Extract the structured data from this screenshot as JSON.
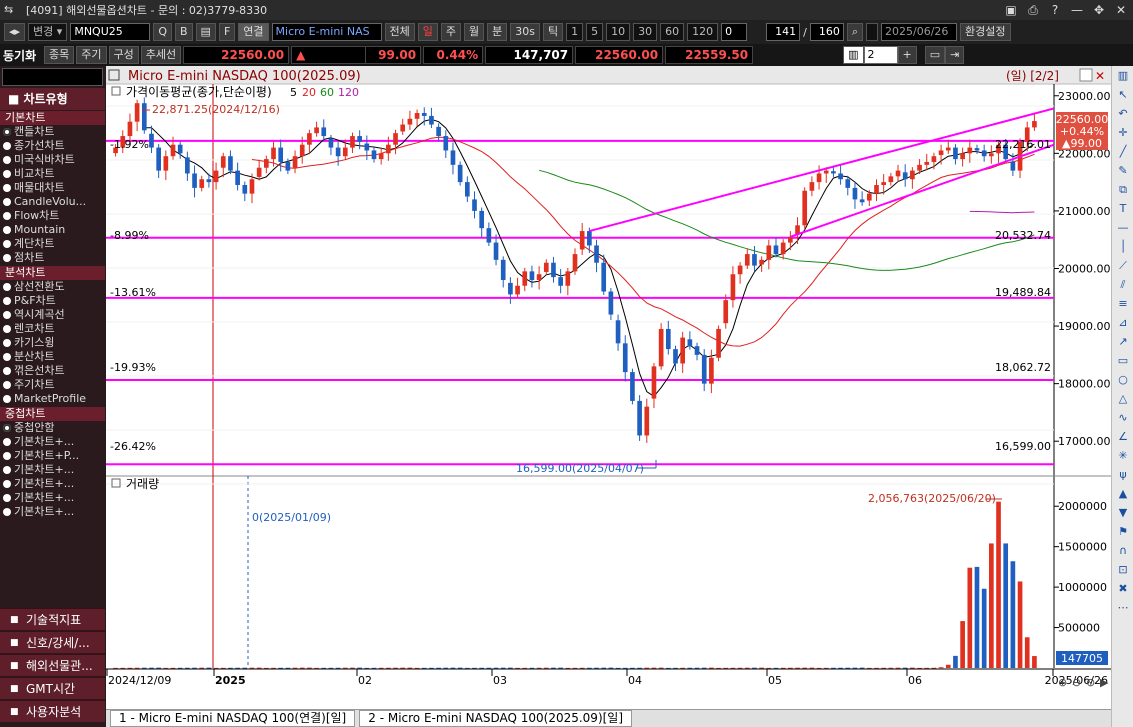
{
  "window": {
    "title": "[4091] 해외선물옵션차트 - 문의 : 02)3779-8330"
  },
  "toolbar": {
    "change_label": "변경",
    "symbol": "MNQU25",
    "connect_label": "연결",
    "symbol_name": "Micro E-mini NAS",
    "all_label": "전체",
    "periods": [
      "일",
      "주",
      "월",
      "분",
      "30s",
      "틱"
    ],
    "intervals": [
      "1",
      "5",
      "10",
      "30",
      "60",
      "120"
    ],
    "field_0": "0",
    "count": "141",
    "total": "160",
    "date": "2025/06/26",
    "settings_label": "환경설정"
  },
  "quote_bar": {
    "sync_label": "동기화",
    "item_label": "종목",
    "cycle_label": "주기",
    "compose_label": "구성",
    "trend_label": "추세선",
    "price": "22560.00",
    "change_arrow": "▲",
    "change": "99.00",
    "change_pct": "0.44%",
    "volume": "147,707",
    "bid": "22560.00",
    "ask": "22559.50",
    "layout_num": "2"
  },
  "sidebar": {
    "header": "차트유형",
    "groups": [
      {
        "name": "기본차트",
        "items": [
          "캔들차트",
          "종가선차트",
          "미국식바차트",
          "비교차트",
          "매물대차트",
          "CandleVolu...",
          "Flow차트",
          "Mountain",
          "계단차트",
          "점차트"
        ]
      },
      {
        "name": "분석차트",
        "items": [
          "삼선전환도",
          "P&F차트",
          "역시계곡선",
          "렌코차트",
          "카기스윙",
          "분산차트",
          "꺾은선차트",
          "주기차트",
          "MarketProfile"
        ]
      },
      {
        "name": "중첩차트",
        "items": [
          "중첩안함",
          "기본차트+...",
          "기본차트+P...",
          "기본차트+...",
          "기본차트+...",
          "기본차트+...",
          "기본차트+..."
        ]
      }
    ],
    "bottom": [
      "기술적지표",
      "신호/강세/...",
      "해외선물관...",
      "GMT시간",
      "사용자분석"
    ]
  },
  "chart": {
    "title": "Micro E-mini NASDAQ 100(2025.09)",
    "period_tag": "(일) [2/2]",
    "ma_label": "가격이동평균(종가,단순이평)",
    "ma_periods": [
      "5",
      "20",
      "60",
      "120"
    ],
    "colors": {
      "ma5": "#000000",
      "ma20": "#e02020",
      "ma60": "#1a8a1a",
      "ma120": "#b020b0",
      "up": "#e03020",
      "down": "#1f5fbf",
      "line": "#ff00ff"
    },
    "high_annotation": "22,871.25(2024/12/16)",
    "low_annotation": "16,599.00(2025/04/07)",
    "levels": [
      {
        "pct": "-1.92%",
        "value": "22,216.01",
        "price": 22216.01
      },
      {
        "pct": "-8.99%",
        "value": "20,532.74",
        "price": 20532.74
      },
      {
        "pct": "-13.61%",
        "value": "19,489.84",
        "price": 19489.84
      },
      {
        "pct": "-19.93%",
        "value": "18,062.72",
        "price": 18062.72
      },
      {
        "pct": "-26.42%",
        "value": "16,599.00",
        "price": 16599.0
      }
    ],
    "price_ticks": [
      "23000.00",
      "22000.00",
      "21000.00",
      "20000.00",
      "19000.00",
      "18000.00",
      "17000.00"
    ],
    "last_price": "22560.00",
    "last_pct": "+0.44%",
    "last_change": "▲99.00",
    "volume_label": "거래량",
    "volume_annotation": "2,056,763(2025/06/20)",
    "volume_marker": "0(2025/01/09)",
    "volume_ticks": [
      "2000000",
      "1500000",
      "1000000",
      "500000"
    ],
    "last_volume": "147705",
    "date_labels": [
      "2024/12/09",
      "2025",
      "02",
      "03",
      "04",
      "05",
      "06",
      "2025/06/26"
    ]
  },
  "chart_data": {
    "type": "candlestick",
    "title": "Micro E-mini NASDAQ 100(2025.09)",
    "ylim": [
      16500,
      23100
    ],
    "x_range": [
      "2024/12/09",
      "2025/06/26"
    ],
    "closes": [
      22100,
      22300,
      22550,
      22871,
      22400,
      22100,
      21700,
      21950,
      22150,
      22000,
      21650,
      21400,
      21550,
      21500,
      21700,
      21950,
      21700,
      21450,
      21300,
      21550,
      21750,
      21900,
      22100,
      21850,
      21700,
      21950,
      22150,
      22350,
      22450,
      22300,
      22100,
      21950,
      22100,
      22300,
      22200,
      22050,
      21900,
      22000,
      22150,
      22350,
      22500,
      22600,
      22700,
      22650,
      22500,
      22300,
      22050,
      21800,
      21500,
      21250,
      21000,
      20700,
      20450,
      20150,
      19800,
      19550,
      19700,
      19950,
      19800,
      19900,
      20100,
      19850,
      19700,
      19950,
      20250,
      20650,
      20400,
      20100,
      19600,
      19200,
      18700,
      18200,
      17700,
      17100,
      17600,
      18300,
      18950,
      18600,
      18350,
      18800,
      18650,
      18500,
      18000,
      18450,
      18950,
      19450,
      19900,
      20050,
      20250,
      20050,
      20150,
      20400,
      20250,
      20450,
      20550,
      20750,
      21350,
      21500,
      21650,
      21700,
      21650,
      21550,
      21400,
      21200,
      21150,
      21300,
      21450,
      21500,
      21600,
      21700,
      21550,
      21700,
      21800,
      21850,
      21950,
      22050,
      22100,
      21900,
      22000,
      22100,
      22050,
      21950,
      22000,
      22150,
      21900,
      21700,
      22200,
      22450,
      22560
    ],
    "volume_peak": 2056763,
    "series": [
      {
        "name": "5",
        "kind": "ma"
      },
      {
        "name": "20",
        "kind": "ma"
      },
      {
        "name": "60",
        "kind": "ma"
      },
      {
        "name": "120",
        "kind": "ma"
      }
    ]
  }
}
